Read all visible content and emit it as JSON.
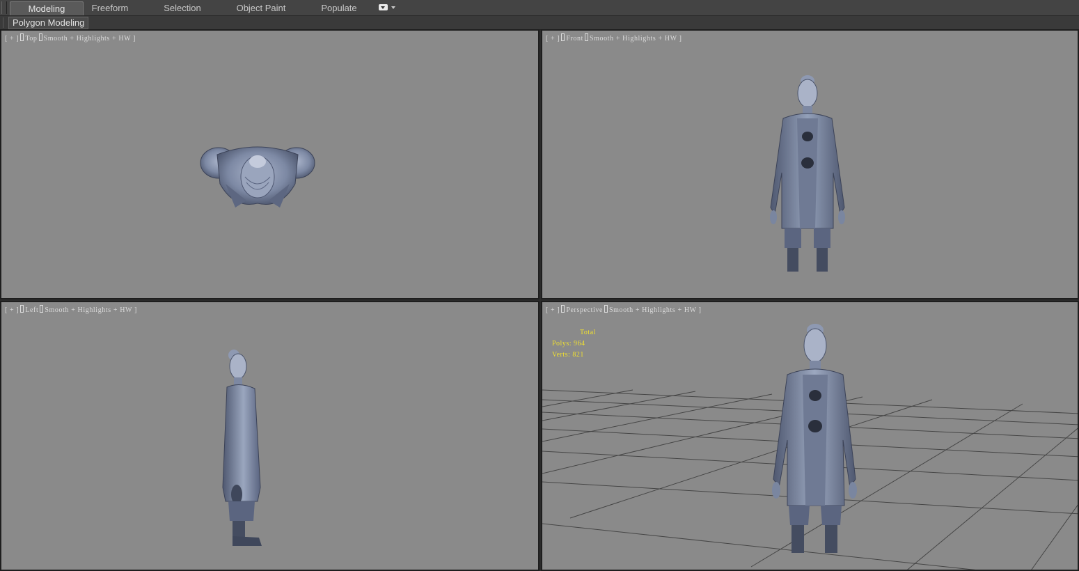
{
  "ribbon": {
    "tabs": [
      {
        "label": "Modeling",
        "active": true
      },
      {
        "label": "Freeform",
        "active": false
      },
      {
        "label": "Selection",
        "active": false
      },
      {
        "label": "Object Paint",
        "active": false
      },
      {
        "label": "Populate",
        "active": false
      }
    ],
    "menu_icon": "dropdown-icon"
  },
  "subbar": {
    "panel_label": "Polygon Modeling"
  },
  "viewports": {
    "top": {
      "plus": "[ + ]",
      "view": "Top",
      "shading": "Smooth + Highlights + HW ]"
    },
    "front": {
      "plus": "[ + ]",
      "view": "Front",
      "shading": "Smooth + Highlights + HW ]"
    },
    "left": {
      "plus": "[ + ]",
      "view": "Left",
      "shading": "Smooth + Highlights + HW ]"
    },
    "perspective": {
      "plus": "[ + ]",
      "view": "Perspective",
      "shading": "Smooth + Highlights + HW ]",
      "stats": {
        "header": "Total",
        "polys_label": "Polys:",
        "polys_value": "964",
        "verts_label": "Verts:",
        "verts_value": "821"
      }
    }
  },
  "colors": {
    "viewport_bg": "#8a8a8a",
    "model": "#7f8ca6",
    "model_dark": "#4a536a",
    "stats_text": "#f0e030",
    "grid_line": "#303030"
  }
}
